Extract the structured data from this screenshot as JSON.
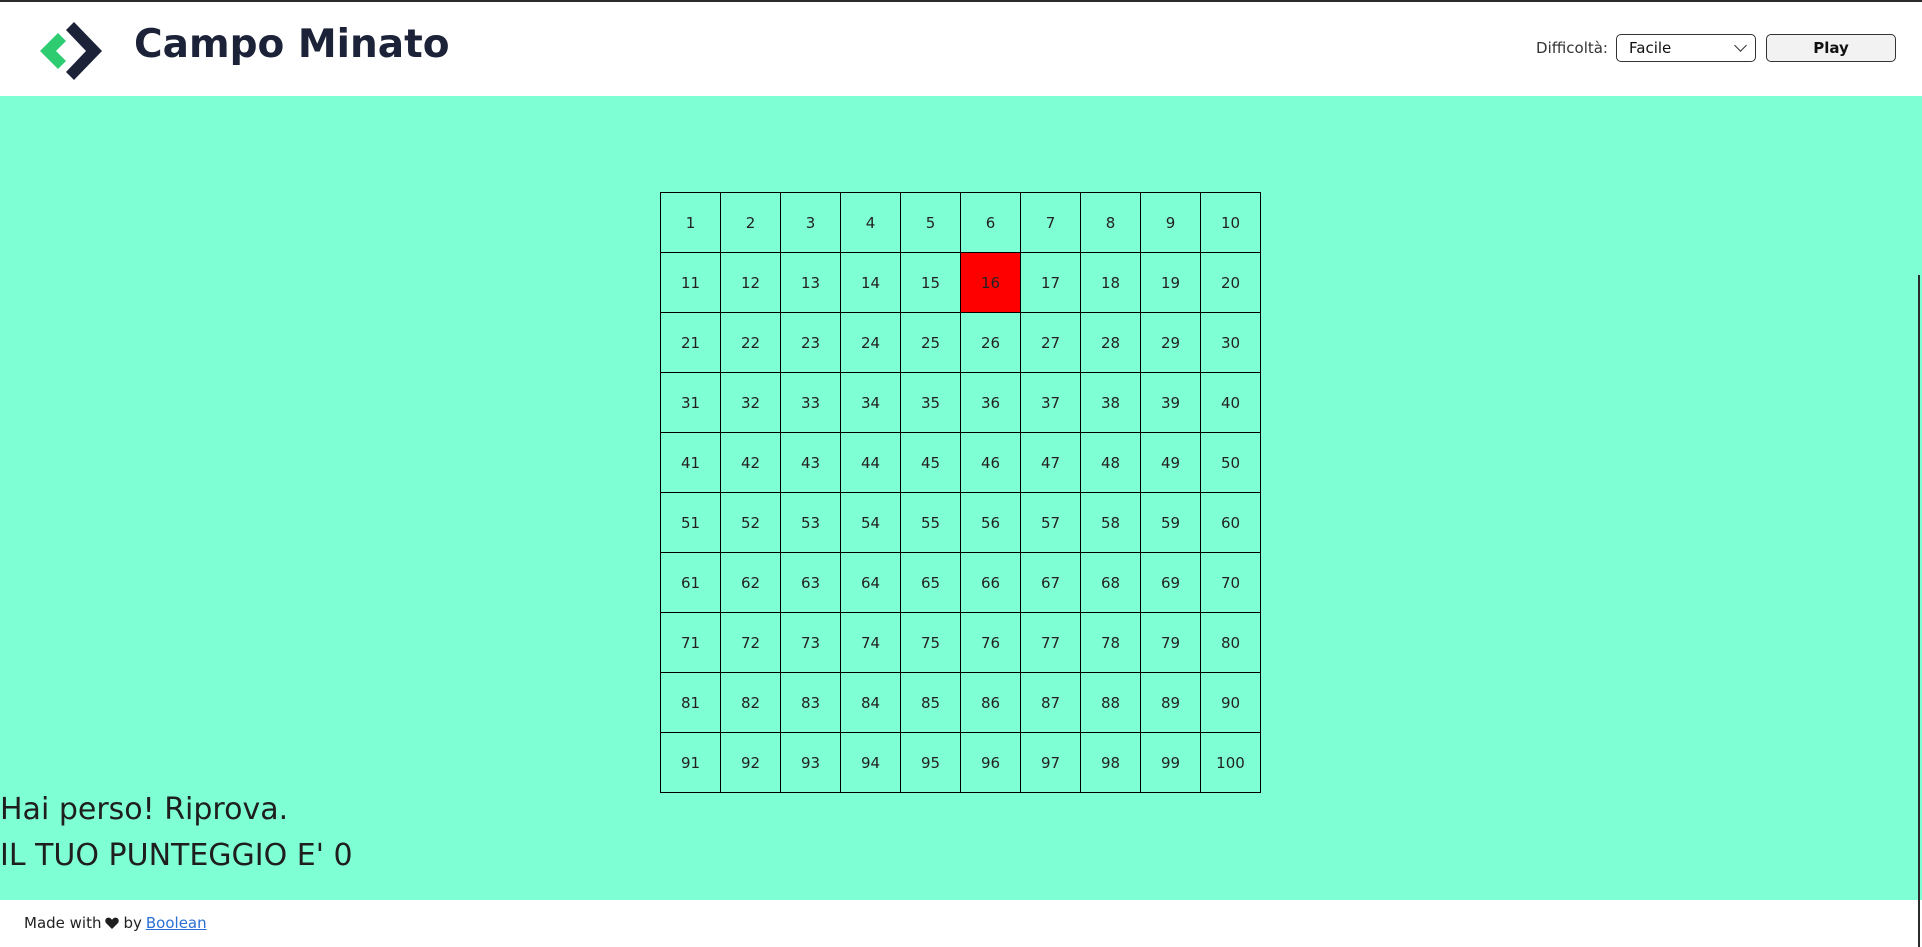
{
  "header": {
    "title": "Campo Minato",
    "logo_icon": "boolean-logo-icon",
    "difficulty_label": "Difficoltà:",
    "difficulty_selected": "Facile",
    "play_label": "Play"
  },
  "board": {
    "cells": [
      "1",
      "2",
      "3",
      "4",
      "5",
      "6",
      "7",
      "8",
      "9",
      "10",
      "11",
      "12",
      "13",
      "14",
      "15",
      "16",
      "17",
      "18",
      "19",
      "20",
      "21",
      "22",
      "23",
      "24",
      "25",
      "26",
      "27",
      "28",
      "29",
      "30",
      "31",
      "32",
      "33",
      "34",
      "35",
      "36",
      "37",
      "38",
      "39",
      "40",
      "41",
      "42",
      "43",
      "44",
      "45",
      "46",
      "47",
      "48",
      "49",
      "50",
      "51",
      "52",
      "53",
      "54",
      "55",
      "56",
      "57",
      "58",
      "59",
      "60",
      "61",
      "62",
      "63",
      "64",
      "65",
      "66",
      "67",
      "68",
      "69",
      "70",
      "71",
      "72",
      "73",
      "74",
      "75",
      "76",
      "77",
      "78",
      "79",
      "80",
      "81",
      "82",
      "83",
      "84",
      "85",
      "86",
      "87",
      "88",
      "89",
      "90",
      "91",
      "92",
      "93",
      "94",
      "95",
      "96",
      "97",
      "98",
      "99",
      "100"
    ],
    "exploded_cell": 16,
    "background_color": "#7fffd4",
    "bomb_color": "#ff0000"
  },
  "messages": {
    "result": "Hai perso! Riprova.",
    "score": "IL TUO PUNTEGGIO E' 0"
  },
  "footer": {
    "made_with": "Made with",
    "heart_icon": "heart-icon",
    "by": "by",
    "link_label": "Boolean"
  }
}
